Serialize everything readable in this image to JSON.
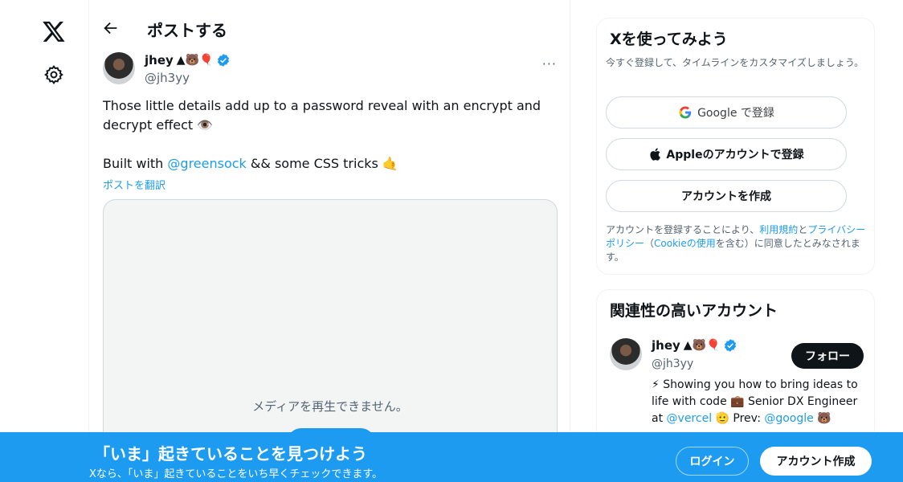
{
  "header": {
    "title": "ポストする"
  },
  "tweet": {
    "author_name": "jhey",
    "author_emoji": "▲🐻🎈",
    "handle": "@jh3yy",
    "more_label": "···",
    "text_line1": "Those little details add up to a password reveal with an encrypt and",
    "text_line2": "decrypt effect 👁️",
    "text_line3_pre": "Built with ",
    "text_line3_mention": "@greensock",
    "text_line3_post": " && some CSS tricks 🤙",
    "translate_label": "ポストを翻訳",
    "media_message": "メディアを再生できません。"
  },
  "signup_card": {
    "title": "Xを使ってみよう",
    "subtitle": "今すぐ登録して、タイムラインをカスタマイズしましょう。",
    "google_label": "Google で登録",
    "apple_label": "Appleのアカウントで登録",
    "create_label": "アカウントを作成",
    "terms_pre": "アカウントを登録することにより、",
    "terms_link1": "利用規約",
    "terms_mid1": "と",
    "terms_link2": "プライバシーポリシー",
    "terms_mid2": "（",
    "terms_link3": "Cookieの使用",
    "terms_post": "を含む）に同意したとみなされます。"
  },
  "related_card": {
    "title": "関連性の高いアカウント",
    "name": "jhey",
    "emoji": "▲🐻🎈",
    "handle": "@jh3yy",
    "follow_label": "フォロー",
    "bio_line1": "⚡ Showing you how to bring ideas to",
    "bio_line2": "life with code 💼 Senior DX Engineer",
    "bio_line3_pre": "at ",
    "bio_mention1": "@vercel",
    "bio_line3_mid": " 🫡 Prev: ",
    "bio_mention2": "@google",
    "bio_line3_post": " 🐻"
  },
  "banner": {
    "title": "「いま」起きていることを見つけよう",
    "subtitle": "Xなら、「いま」起きていることをいち早くチェックできます。",
    "login_label": "ログイン",
    "signup_label": "アカウント作成"
  },
  "colors": {
    "accent": "#1d9bf0",
    "text": "#0f1419",
    "muted": "#536471"
  }
}
